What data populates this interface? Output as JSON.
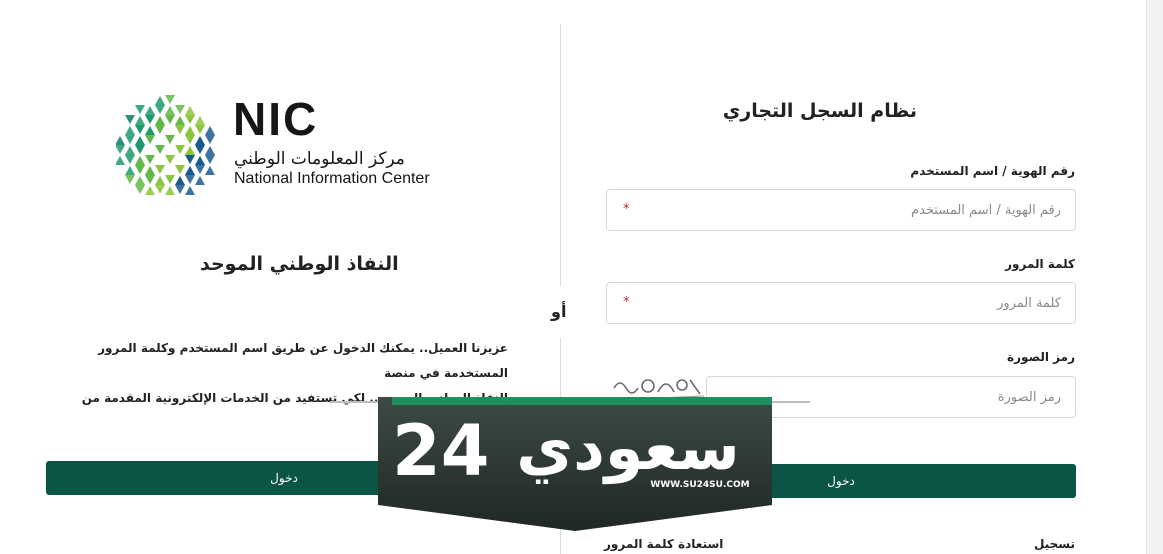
{
  "commercial_register": {
    "title": "نظام السجل التجاري",
    "id_label": "رقم الهوية / اسم المستخدم",
    "id_placeholder": "رقم الهوية / اسم المستخدم",
    "password_label": "كلمة المرور",
    "password_placeholder": "كلمة المرور",
    "captcha_label": "رمز الصورة",
    "captcha_placeholder": "رمز الصورة",
    "required_mark": "*",
    "login_label": "دخول",
    "register_link": "تسجيل",
    "recover_link": "استعادة كلمة المرور"
  },
  "separator": {
    "or_label": "أو"
  },
  "nic": {
    "acronym": "NIC",
    "arabic_name": "مركز المعلومات الوطني",
    "english_name": "National Information Center",
    "brand_colors": [
      "#0b7a6b",
      "#1d9a6c",
      "#62b948",
      "#8cc63f",
      "#1b5a8f"
    ]
  },
  "nafath": {
    "title": "النفاذ الوطني الموحد",
    "description_line1": "عزيزنا العميل.. يمكنك الدخول عن طريق اسم المستخدم وكلمة المرور المستخدمة في منصة",
    "description_line2": "النفاذ الوطني الموحد .. لكي تستفيد من الخدمات الإلكترونية المقدمة من وزارة التجارة ..",
    "login_label": "دخول"
  },
  "watermark": {
    "arabic_text": "سعودي",
    "number": "24",
    "url": "WWW.SU24SU.COM",
    "accent_color": "#1f8f5f"
  }
}
